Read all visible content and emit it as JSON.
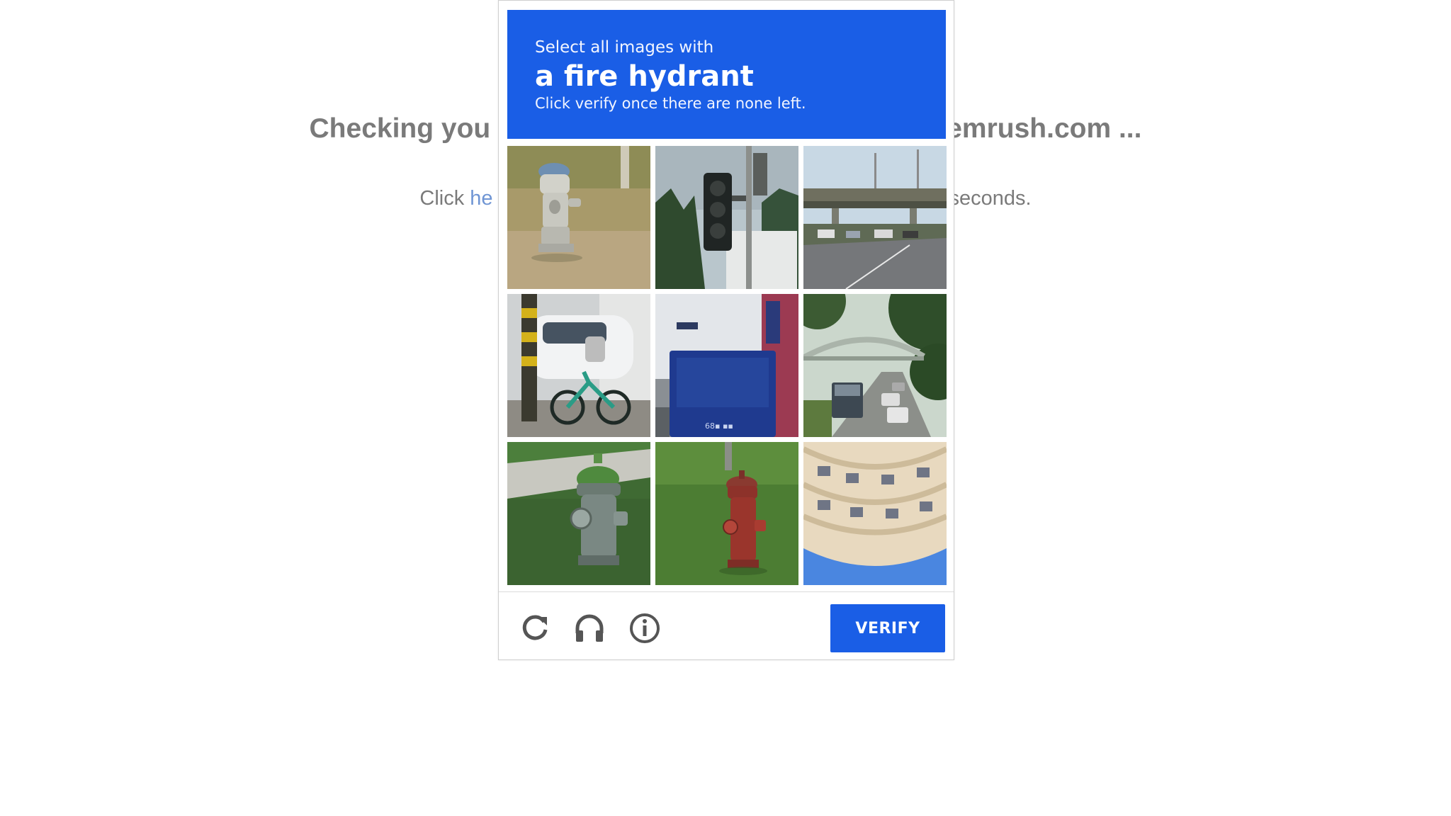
{
  "background_page": {
    "heading_left": "Checking you",
    "heading_right": "emrush.com ...",
    "line_prefix": "Click ",
    "line_link": "he",
    "line_suffix": "seconds."
  },
  "captcha": {
    "instruction": "Select all images with",
    "target": "a fire hydrant",
    "hint": "Click verify once there are none left.",
    "verify_label": "VERIFY",
    "header_color": "#1a5ee6",
    "tiles": [
      "fire-hydrant-on-dry-grass",
      "traffic-light",
      "highway-overpass",
      "bicycle-and-parked-cars",
      "blue-street-sign",
      "pedestrian-bridge-over-road",
      "green-fire-hydrant",
      "red-fire-hydrant",
      "building-facade-sky"
    ],
    "controls": [
      "reload-icon",
      "headphones-icon",
      "info-icon"
    ]
  }
}
